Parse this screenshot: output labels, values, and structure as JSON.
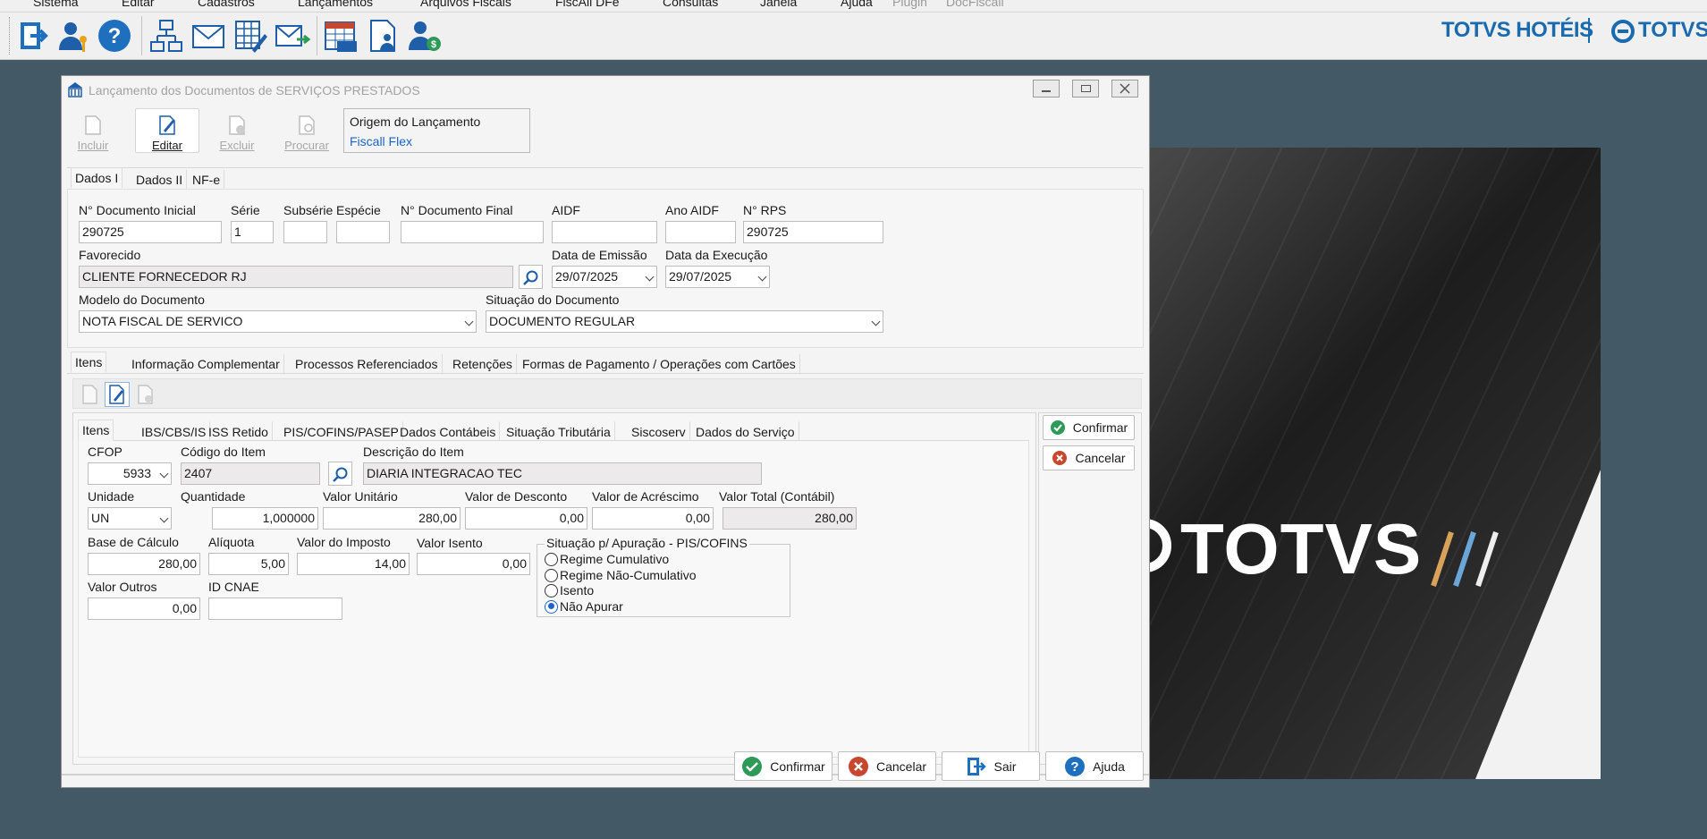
{
  "menu": [
    "Sistema",
    "Editar",
    "Cadastros",
    "Lançamentos",
    "Arquivos Fiscais",
    "FiscAll DFe",
    "Consultas",
    "Janela",
    "Ajuda",
    "Plugin",
    "DocFiscall"
  ],
  "brand": {
    "hoteis": "TOTVS HOTÉIS",
    "totvs": "TOTVS",
    "splash": "TOTVS"
  },
  "toolbar_icons": [
    "exit-icon",
    "user-key-icon",
    "help-icon",
    "org-chart-icon",
    "mail-icon",
    "edit-grid-icon",
    "send-mail-icon",
    "calendar-icms-icon",
    "user-document-icon",
    "user-money-icon"
  ],
  "window": {
    "title": "Lançamento dos Documentos de SERVIÇOS PRESTADOS"
  },
  "actions": {
    "incluir": "Incluir",
    "editar": "Editar",
    "excluir": "Excluir",
    "procurar": "Procurar"
  },
  "origem": {
    "label": "Origem do Lançamento",
    "value": "Fiscall Flex"
  },
  "top_tabs": [
    "Dados I",
    "Dados II",
    "NF-e"
  ],
  "dados": {
    "num_inicial_label": "N° Documento Inicial",
    "num_inicial": "290725",
    "serie_label": "Série",
    "serie": "1",
    "subserie_label": "Subsérie",
    "especie_label": "Espécie",
    "num_final_label": "N° Documento Final",
    "aidf_label": "AIDF",
    "ano_aidf_label": "Ano AIDF",
    "rps_label": "N° RPS",
    "rps": "290725",
    "favorecido_label": "Favorecido",
    "favorecido": "CLIENTE FORNECEDOR RJ",
    "emissao_label": "Data de Emissão",
    "emissao": "29/07/2025",
    "execucao_label": "Data da Execução",
    "execucao": "29/07/2025",
    "modelo_label": "Modelo do Documento",
    "modelo": "NOTA FISCAL DE SERVICO",
    "situacao_label": "Situação do Documento",
    "situacao": "DOCUMENTO REGULAR"
  },
  "mid_tabs": [
    "Itens",
    "Informação Complementar",
    "Processos Referenciados",
    "Retenções",
    "Formas de Pagamento / Operações com Cartões"
  ],
  "item_tabs": [
    "Itens",
    "IBS/CBS/IS",
    "ISS Retido",
    "PIS/COFINS/PASEP",
    "Dados Contábeis",
    "Situação Tributária",
    "Siscoserv",
    "Dados do Serviço"
  ],
  "item": {
    "cfop_label": "CFOP",
    "cfop": "5933",
    "codigo_label": "Código do Item",
    "codigo": "2407",
    "descricao_label": "Descrição do Item",
    "descricao": "DIARIA INTEGRACAO TEC",
    "unidade_label": "Unidade",
    "unidade": "UN",
    "quantidade_label": "Quantidade",
    "quantidade": "1,000000",
    "valor_unit_label": "Valor Unitário",
    "valor_unit": "280,00",
    "desconto_label": "Valor de Desconto",
    "desconto": "0,00",
    "acrescimo_label": "Valor de Acréscimo",
    "acrescimo": "0,00",
    "total_label": "Valor Total (Contábil)",
    "total": "280,00",
    "base_label": "Base de Cálculo",
    "base": "280,00",
    "aliquota_label": "Alíquota",
    "aliquota": "5,00",
    "imposto_label": "Valor do Imposto",
    "imposto": "14,00",
    "isento_label": "Valor Isento",
    "isento": "0,00",
    "outros_label": "Valor Outros",
    "outros": "0,00",
    "cnae_label": "ID CNAE"
  },
  "apuracao": {
    "title": "Situação p/ Apuração - PIS/COFINS",
    "options": [
      "Regime Cumulativo",
      "Regime Não-Cumulativo",
      "Isento",
      "Não Apurar"
    ],
    "selected": "Não Apurar"
  },
  "side_buttons": {
    "confirmar": "Confirmar",
    "cancelar": "Cancelar"
  },
  "bottom_buttons": {
    "confirmar": "Confirmar",
    "cancelar": "Cancelar",
    "sair": "Sair",
    "ajuda": "Ajuda"
  },
  "colors": {
    "accent": "#1e63c9",
    "brand_blue": "#1a6ab0",
    "desktop": "#435a66",
    "confirm_green": "#2e9a57",
    "cancel_red": "#c8472f"
  }
}
